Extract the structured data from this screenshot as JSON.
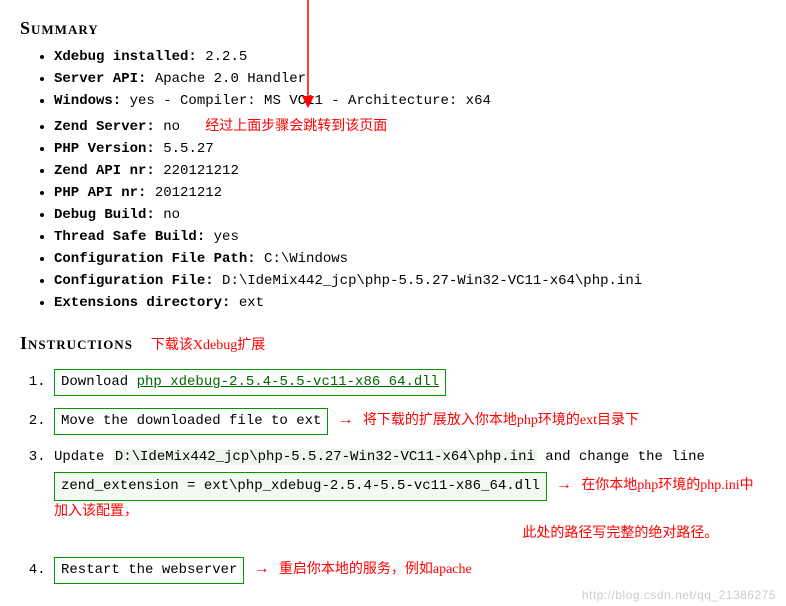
{
  "summary": {
    "heading": "Summary",
    "items": [
      {
        "label": "Xdebug installed:",
        "value": "2.2.5"
      },
      {
        "label": "Server API:",
        "value": "Apache 2.0 Handler"
      },
      {
        "label": "Windows:",
        "value": "yes - Compiler: MS VC11 - Architecture: x64"
      },
      {
        "label": "Zend Server:",
        "value": "no"
      },
      {
        "label": "PHP Version:",
        "value": "5.5.27"
      },
      {
        "label": "Zend API nr:",
        "value": "220121212"
      },
      {
        "label": "PHP API nr:",
        "value": "20121212"
      },
      {
        "label": "Debug Build:",
        "value": "no"
      },
      {
        "label": "Thread Safe Build:",
        "value": "yes"
      },
      {
        "label": "Configuration File Path:",
        "value": "C:\\Windows"
      },
      {
        "label": "Configuration File:",
        "value": "D:\\IdeMix442_jcp\\php-5.5.27-Win32-VC11-x64\\php.ini"
      },
      {
        "label": "Extensions directory:",
        "value": "ext"
      }
    ]
  },
  "note_top": "经过上面步骤会跳转到该页面",
  "instructions": {
    "heading": "Instructions",
    "title_note": "下载该Xdebug扩展",
    "step1_prefix": "Download ",
    "step1_link": "php_xdebug-2.5.4-5.5-vc11-x86_64.dll",
    "step2_text": "Move the downloaded file to ext",
    "step2_note": "将下载的扩展放入你本地php环境的ext目录下",
    "step3_prefix": "Update ",
    "step3_code": "D:\\IdeMix442_jcp\\php-5.5.27-Win32-VC11-x64\\php.ini",
    "step3_suffix": " and change the line",
    "step3_line": "zend_extension = ext\\php_xdebug-2.5.4-5.5-vc11-x86_64.dll",
    "step3_note_a": "在你本地php环境的php.ini中加入该配置，",
    "step3_note_b": "此处的路径写完整的绝对路径。",
    "step4_text": "Restart the webserver",
    "step4_note": "重启你本地的服务，例如apache"
  },
  "watermark": "http://blog.csdn.net/qq_21386275"
}
